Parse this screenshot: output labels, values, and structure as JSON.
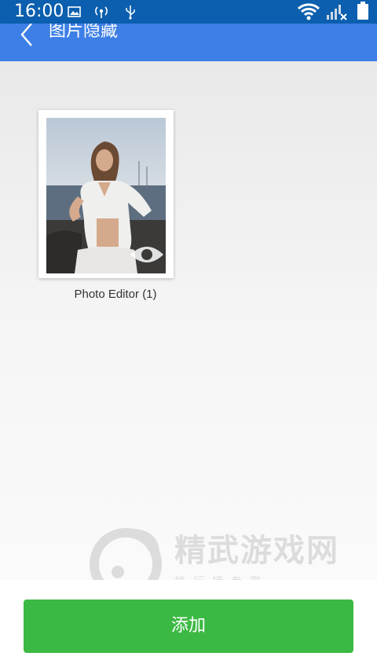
{
  "status_bar": {
    "time": "16:00",
    "icons": [
      "gallery-icon",
      "hotspot-icon",
      "usb-icon",
      "wifi-icon",
      "signal-no-sim-icon",
      "battery-icon"
    ]
  },
  "app_bar": {
    "title": "图片隐藏",
    "back_icon": "chevron-left-icon"
  },
  "albums": [
    {
      "name": "Photo Editor (1)",
      "badge_icon": "eye-icon"
    }
  ],
  "watermark": {
    "title": "精武游戏网",
    "subtitle": "排行榜专家"
  },
  "bottom": {
    "add_label": "添加"
  },
  "colors": {
    "status_bar": "#0b5fae",
    "app_bar": "#3d7fe6",
    "add_button": "#3cb944"
  }
}
